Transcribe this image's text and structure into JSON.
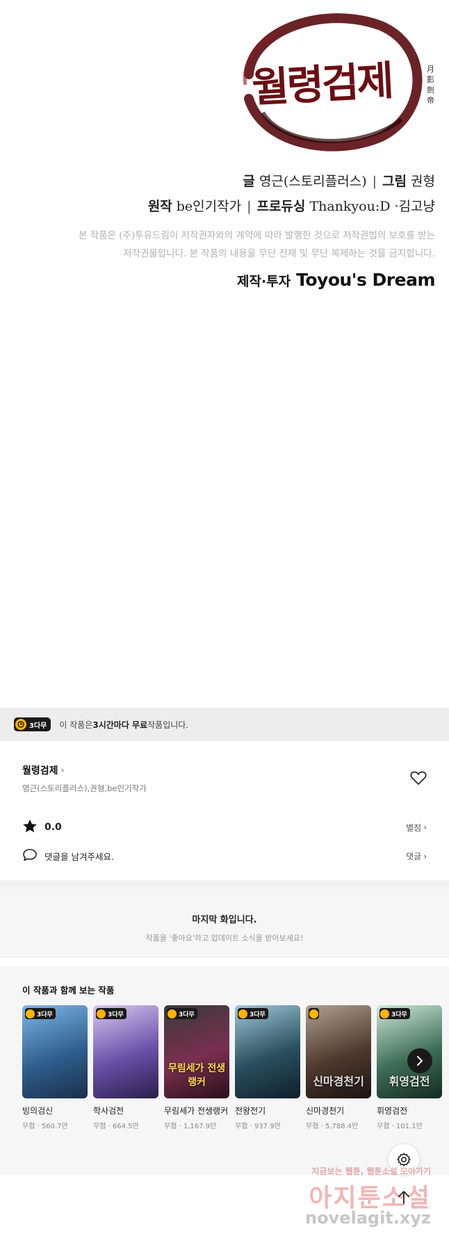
{
  "logo": {
    "title": "월령검제",
    "hanja": "月影劍帝"
  },
  "credits": {
    "story_label": "글",
    "story_value": "영근(스토리플러스)",
    "art_label": "그림",
    "art_value": "권형",
    "original_label": "원작",
    "original_value": "be인기작가",
    "producing_label": "프로듀싱",
    "producing_value": "Thankyou:D ·김고냥",
    "separator": "|",
    "notice_line1": "본 작품은 (주)투유드림이 저작권자와의 계약에 따라 발행한 것으로 저작권법의 보호를 받는",
    "notice_line2": "저작권물입니다. 본 작품의 내용을 무단 전재 및 무단 복제하는 것을 금지합니다.",
    "producer_label": "제작·투자",
    "producer_brand": "Toyou's Dream"
  },
  "banner": {
    "badge": "3다무",
    "text_pre": "이 작품은 ",
    "text_bold": "3시간마다 무료",
    "text_post": " 작품입니다."
  },
  "work": {
    "title": "월령검제",
    "authors": "영근(스토리플러스),권형,be인기작가",
    "rating": "0.0",
    "rating_link": "별점",
    "comment_prompt": "댓글을 남겨주세요.",
    "comment_link": "댓글"
  },
  "last_episode": {
    "title": "마지막 화입니다.",
    "subtitle": "작품을 '좋아요'하고 업데이트 소식을 받아보세요!"
  },
  "recommendations": {
    "heading": "이 작품과 함께 보는 작품",
    "items": [
      {
        "badge": "3다무",
        "art": "",
        "name": "빙의검신",
        "meta": "무협 · 560.7만",
        "bg": "#2f5f8f"
      },
      {
        "badge": "3다무",
        "art": "",
        "name": "학사검전",
        "meta": "무협 · 664.5만",
        "bg": "#6a4fa8"
      },
      {
        "badge": "3다무",
        "art": "무림세가 전생랭커",
        "name": "무림세가 전생랭커",
        "meta": "무협 · 1,167.9만",
        "bg": "#7a2f4f"
      },
      {
        "badge": "3다무",
        "art": "",
        "name": "전왕전기",
        "meta": "무협 · 937.9만",
        "bg": "#2a4f5f"
      },
      {
        "badge": "",
        "art": "신마경천기",
        "name": "신마경천기",
        "meta": "무협 · 5,788.4만",
        "bg": "#4f3a2f"
      },
      {
        "badge": "3다무",
        "art": "휘영검전",
        "name": "휘영검전",
        "meta": "무협 · 101.1만",
        "bg": "#3f6f5a"
      }
    ]
  },
  "watermark": {
    "line1": "지금보는 웹툰, 웹툰소설 모아가기",
    "line2": "아지툰소설",
    "line3": "novelagit.xyz"
  },
  "colors": {
    "logo": "#6b0f14",
    "badge_clock": "#ffb400",
    "banner_bg": "#ededed"
  },
  "icons": {
    "heart": "heart-icon",
    "star": "star-icon",
    "comment": "comment-icon",
    "settings": "gear-icon",
    "top": "arrow-up-icon",
    "next": "chevron-right-icon"
  }
}
